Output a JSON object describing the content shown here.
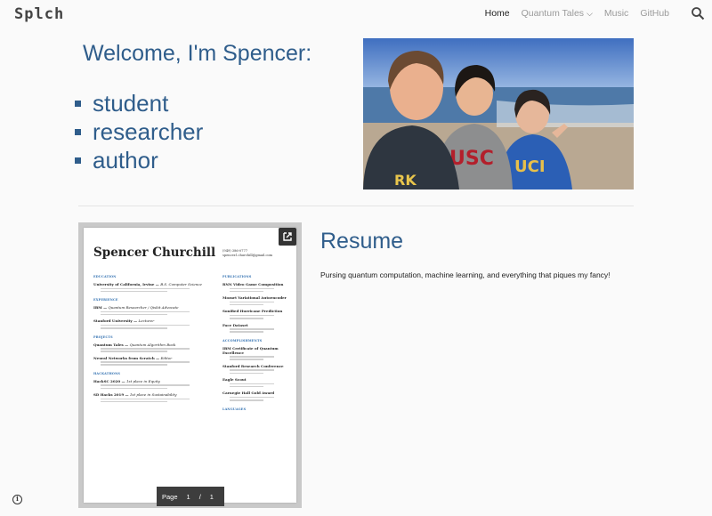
{
  "header": {
    "logo": "Splch",
    "nav": [
      {
        "label": "Home",
        "active": true
      },
      {
        "label": "Quantum Tales",
        "dropdown": true
      },
      {
        "label": "Music"
      },
      {
        "label": "GitHub"
      }
    ],
    "search_icon": "search-icon"
  },
  "hero": {
    "title": "Welcome, I'm Spencer:",
    "roles": [
      "student",
      "researcher",
      "author"
    ]
  },
  "resume_preview": {
    "name": "Spencer Churchill",
    "contact": [
      "(949) 386-0777",
      "spencer.l.churchill@gmail.com"
    ],
    "left": [
      {
        "heading": "EDUCATION"
      },
      {
        "entry": "University of California, Irvine — ",
        "italic": "B.S. Computer Science"
      },
      {
        "heading": "EXPERIENCE"
      },
      {
        "entry": "IBM — ",
        "italic": "Quantum Researcher / Qiskit Advocate"
      },
      {
        "entry": "Stanford University — ",
        "italic": "Lecturer"
      },
      {
        "heading": "PROJECTS"
      },
      {
        "entry": "Quantum Tales — ",
        "italic": "Quantum Algorithm Book"
      },
      {
        "entry": "Neural Networks from Scratch — ",
        "italic": "Editor"
      },
      {
        "heading": "HACKATHONS"
      },
      {
        "entry": "HackSC 2020 — ",
        "italic": "1st place in Equity"
      },
      {
        "entry": "SD Hacks 2019 — ",
        "italic": "1st place in Sustainability"
      }
    ],
    "right": [
      {
        "heading": "PUBLICATIONS"
      },
      {
        "entry": "RNN Video Game Composition"
      },
      {
        "entry": "Mozart Variational Autoencoder"
      },
      {
        "entry": "Sonified Hurricane Prediction"
      },
      {
        "entry": "Face Dataset"
      },
      {
        "heading": "ACCOMPLISHMENTS"
      },
      {
        "entry": "IBM Certificate of Quantum Excellence"
      },
      {
        "entry": "Stanford Research Conference"
      },
      {
        "entry": "Eagle Scout"
      },
      {
        "entry": "Carnegie Hall Gold Award"
      },
      {
        "heading": "LANGUAGES"
      }
    ],
    "pager": {
      "label": "Page",
      "current": "1",
      "sep": "/",
      "total": "1"
    }
  },
  "resume": {
    "title": "Resume",
    "text": "Pursing quantum computation, machine learning, and everything that piques my fancy!"
  },
  "colors": {
    "accent": "#2f5d8b",
    "nav_inactive": "#9a9a9a"
  }
}
